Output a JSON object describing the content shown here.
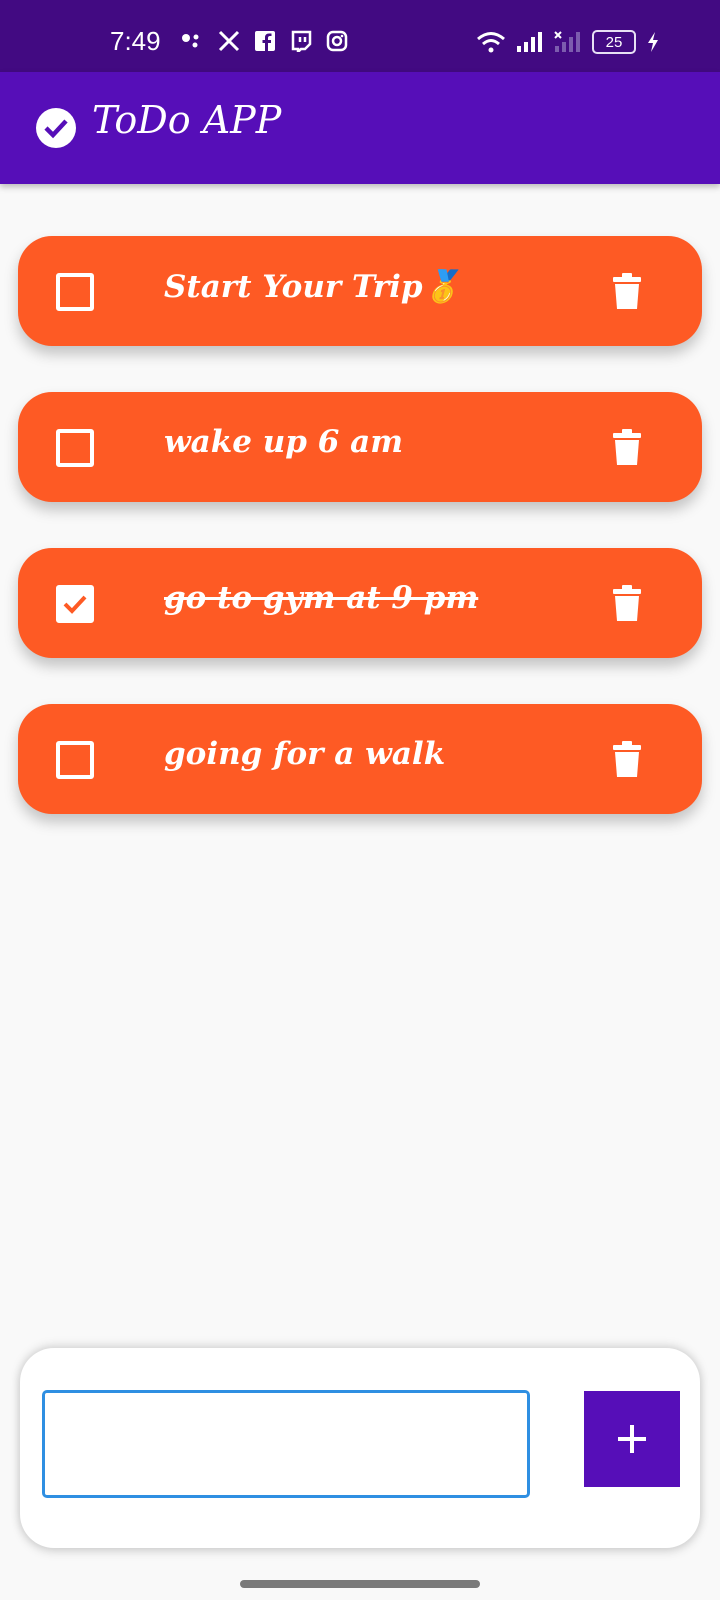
{
  "status_bar": {
    "time": "7:49",
    "battery_level": "25",
    "left_icons": [
      "assistant-dots-icon",
      "x-icon",
      "facebook-icon",
      "twitch-icon",
      "instagram-icon"
    ],
    "right_icons": [
      "wifi-icon",
      "signal-icon",
      "signal-no-service-icon",
      "battery-icon",
      "charging-icon"
    ]
  },
  "app_bar": {
    "title": "ToDo APP",
    "icon": "check-circle-icon",
    "color": "#560eb8"
  },
  "tasks": [
    {
      "label": "Start Your Trip",
      "emoji": "🥇",
      "checked": false
    },
    {
      "label": "wake up 6 am",
      "checked": false
    },
    {
      "label": "go to gym at 9 pm",
      "checked": true
    },
    {
      "label": "going for a walk",
      "checked": false
    }
  ],
  "task_card_color": "#fe5a24",
  "input": {
    "value": "",
    "placeholder": ""
  },
  "add_button": {
    "icon": "plus-icon",
    "color": "#560eb8"
  }
}
